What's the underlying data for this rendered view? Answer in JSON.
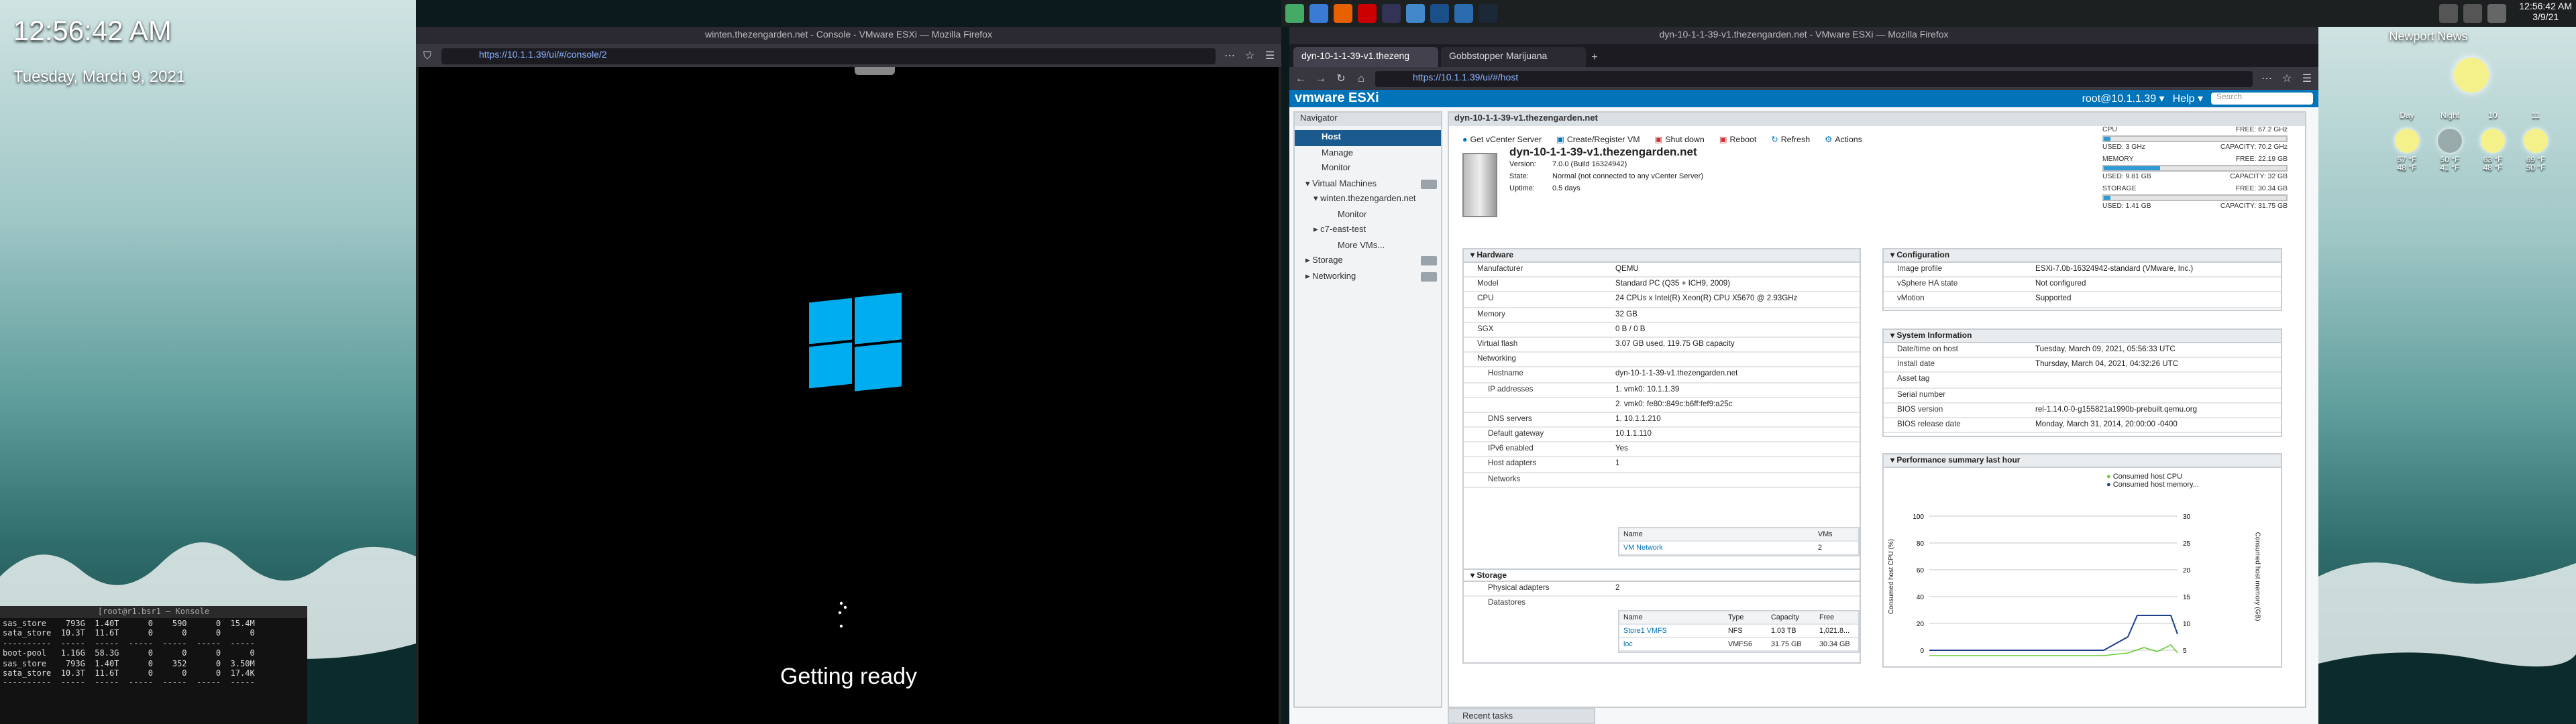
{
  "desktop": {
    "clock": "12:56:42 AM",
    "date": "Tuesday, March 9, 2021"
  },
  "terminal": {
    "title": "[root@r1.bsr1 — Konsole",
    "lines": [
      "sas_store    793G  1.40T      0    590      0  15.4M",
      "sata_store  10.3T  11.6T      0      0      0      0",
      "----------  -----  -----  -----  -----  -----  -----",
      "boot-pool   1.16G  58.3G      0      0      0      0",
      "sas_store    793G  1.40T      0    352      0  3.50M",
      "sata_store  10.3T  11.6T      0      0      0  17.4K",
      "----------  -----  -----  -----  -----  -----  -----"
    ]
  },
  "console_window": {
    "title": "winten.thezengarden.net - Console - VMware ESXi — Mozilla Firefox",
    "url": "https://10.1.1.39/ui/#/console/2",
    "status": "Getting ready"
  },
  "esxi_window": {
    "title": "dyn-10-1-1-39-v1.thezengarden.net - VMware ESXi — Mozilla Firefox",
    "tabs": [
      "dyn-10-1-1-39-v1.thezeng",
      "Gobbstopper Marijuana"
    ],
    "url": "https://10.1.1.39/ui/#/host",
    "header": {
      "logo": "vmware ESXi",
      "user": "root@10.1.1.39 ▾",
      "help": "Help ▾",
      "search": "Search"
    },
    "navigator": {
      "title": "Navigator",
      "items": [
        "Host",
        "Manage",
        "Monitor",
        "Virtual Machines",
        "winten.thezengarden.net",
        "Monitor",
        "c7-east-test",
        "More VMs...",
        "Storage",
        "Networking"
      ]
    },
    "panel_title": "dyn-10-1-1-39-v1.thezengarden.net",
    "toolbar": [
      "Get vCenter Server",
      "Create/Register VM",
      "Shut down",
      "Reboot",
      "Refresh",
      "Actions"
    ],
    "host": {
      "name": "dyn-10-1-1-39-v1.thezengarden.net",
      "version_label": "Version:",
      "version": "7.0.0 (Build 16324942)",
      "state_label": "State:",
      "state": "Normal (not connected to any vCenter Server)",
      "uptime_label": "Uptime:",
      "uptime": "0.5 days"
    },
    "resources": [
      {
        "name": "CPU",
        "free": "FREE: 67.2 GHz",
        "pct": "4%",
        "used": "USED: 3 GHz",
        "cap": "CAPACITY: 70.2 GHz",
        "level": 0.04
      },
      {
        "name": "MEMORY",
        "free": "FREE: 22.19 GB",
        "pct": "31%",
        "used": "USED: 9.81 GB",
        "cap": "CAPACITY: 32 GB",
        "level": 0.31
      },
      {
        "name": "STORAGE",
        "free": "FREE: 30.34 GB",
        "pct": "0%",
        "used": "USED: 1.41 GB",
        "cap": "CAPACITY: 31.75 GB",
        "level": 0.04
      }
    ],
    "hardware": {
      "title": "Hardware",
      "rows": [
        [
          "Manufacturer",
          "QEMU"
        ],
        [
          "Model",
          "Standard PC (Q35 + ICH9, 2009)"
        ],
        [
          "CPU",
          "24 CPUs x Intel(R) Xeon(R) CPU X5670 @ 2.93GHz"
        ],
        [
          "Memory",
          "32 GB"
        ],
        [
          "SGX",
          "0 B / 0 B"
        ],
        [
          "Virtual flash",
          "3.07 GB used, 119.75 GB capacity"
        ],
        [
          "Networking",
          ""
        ],
        [
          "Hostname",
          "dyn-10-1-1-39-v1.thezengarden.net"
        ],
        [
          "IP addresses",
          "1. vmk0: 10.1.1.39"
        ],
        [
          "",
          "2. vmk0: fe80::849c:b6ff:fef9:a25c"
        ],
        [
          "DNS servers",
          "1. 10.1.1.210"
        ],
        [
          "Default gateway",
          "10.1.1.110"
        ],
        [
          "IPv6 enabled",
          "Yes"
        ],
        [
          "Host adapters",
          "1"
        ],
        [
          "Networks",
          ""
        ]
      ]
    },
    "networks_table": {
      "headers": [
        "Name",
        "VMs"
      ],
      "rows": [
        [
          "VM Network",
          "2"
        ]
      ]
    },
    "storage": {
      "title": "Storage",
      "rows": [
        [
          "Physical adapters",
          "2"
        ],
        [
          "Datastores",
          ""
        ]
      ]
    },
    "datastores_table": {
      "headers": [
        "Name",
        "Type",
        "Capacity",
        "Free"
      ],
      "rows": [
        [
          "Store1 VMFS",
          "NFS",
          "1.03 TB",
          "1,021.8..."
        ],
        [
          "loc",
          "VMFS6",
          "31.75 GB",
          "30.34 GB"
        ]
      ]
    },
    "configuration": {
      "title": "Configuration",
      "rows": [
        [
          "Image profile",
          "ESXi-7.0b-16324942-standard (VMware, Inc.)"
        ],
        [
          "vSphere HA state",
          "Not configured"
        ],
        [
          "vMotion",
          "Supported"
        ]
      ]
    },
    "sysinfo": {
      "title": "System Information",
      "rows": [
        [
          "Date/time on host",
          "Tuesday, March 09, 2021, 05:56:33 UTC"
        ],
        [
          "Install date",
          "Thursday, March 04, 2021, 04:32:26 UTC"
        ],
        [
          "Asset tag",
          ""
        ],
        [
          "Serial number",
          ""
        ],
        [
          "BIOS version",
          "rel-1.14.0-0-g155821a1990b-prebuilt.qemu.org"
        ],
        [
          "BIOS release date",
          "Monday, March 31, 2014, 20:00:00 -0400"
        ]
      ]
    },
    "perf": {
      "title": "Performance summary last hour",
      "legend": [
        "Consumed host CPU",
        "Consumed host memory..."
      ],
      "ylabel_left": "Consumed host CPU (%)",
      "ylabel_right": "Consumed host memory (GB)",
      "yticks_left": [
        "100",
        "80",
        "60",
        "40",
        "20",
        "0"
      ],
      "yticks_right": [
        "30",
        "25",
        "20",
        "15",
        "10",
        "5"
      ]
    },
    "recent_tasks": "Recent tasks"
  },
  "news": {
    "title": "Newport News",
    "days": [
      {
        "label": "Day",
        "hi": "57 °F",
        "lo": "48 °F"
      },
      {
        "label": "Night",
        "hi": "50 °F",
        "lo": "41 °F"
      },
      {
        "label": "10",
        "hi": "63 °F",
        "lo": "48 °F"
      },
      {
        "label": "11",
        "hi": "69 °F",
        "lo": "50 °F"
      }
    ]
  },
  "tray": {
    "time": "12:56:42 AM",
    "date": "3/9/21"
  },
  "colors": {
    "vmware_blue": "#0073b9",
    "win_blue": "#00adef",
    "nav_selected": "#1b5a8e"
  }
}
